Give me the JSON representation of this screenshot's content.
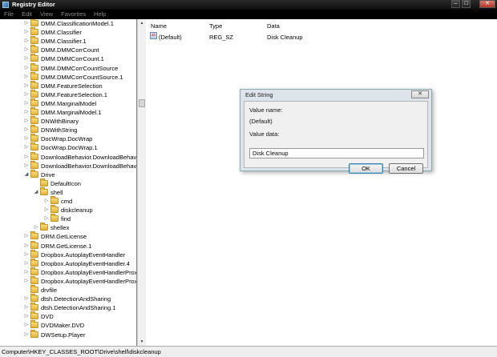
{
  "window": {
    "title": "Registry Editor"
  },
  "menu": [
    "File",
    "Edit",
    "View",
    "Favorites",
    "Help"
  ],
  "tree": {
    "items": [
      {
        "label": "DMM.ClassificationModel.1",
        "level": 0,
        "expand": "▷"
      },
      {
        "label": "DMM.Classifier",
        "level": 0,
        "expand": "▷"
      },
      {
        "label": "DMM.Classifier.1",
        "level": 0,
        "expand": "▷"
      },
      {
        "label": "DMM.DMMCorrCount",
        "level": 0,
        "expand": "▷"
      },
      {
        "label": "DMM.DMMCorrCount.1",
        "level": 0,
        "expand": "▷"
      },
      {
        "label": "DMM.DMMCorrCountSource",
        "level": 0,
        "expand": "▷"
      },
      {
        "label": "DMM.DMMCorrCountSource.1",
        "level": 0,
        "expand": "▷"
      },
      {
        "label": "DMM.FeatureSelection",
        "level": 0,
        "expand": "▷"
      },
      {
        "label": "DMM.FeatureSelection.1",
        "level": 0,
        "expand": "▷"
      },
      {
        "label": "DMM.MarginalModel",
        "level": 0,
        "expand": "▷"
      },
      {
        "label": "DMM.MarginalModel.1",
        "level": 0,
        "expand": "▷"
      },
      {
        "label": "DNWithBinary",
        "level": 0,
        "expand": "▷"
      },
      {
        "label": "DNWithString",
        "level": 0,
        "expand": "▷"
      },
      {
        "label": "DocWrap.DocWrap",
        "level": 0,
        "expand": "▷"
      },
      {
        "label": "DocWrap.DocWrap.1",
        "level": 0,
        "expand": "▷"
      },
      {
        "label": "DownloadBehavior.DownloadBehavic",
        "level": 0,
        "expand": "▷"
      },
      {
        "label": "DownloadBehavior.DownloadBehavic",
        "level": 0,
        "expand": "▷"
      },
      {
        "label": "Drive",
        "level": 0,
        "expand": "◢"
      },
      {
        "label": "DefaultIcon",
        "level": 1,
        "expand": ""
      },
      {
        "label": "shell",
        "level": 1,
        "expand": "◢"
      },
      {
        "label": "cmd",
        "level": 2,
        "expand": "▷"
      },
      {
        "label": "diskcleanup",
        "level": 2,
        "expand": "▷"
      },
      {
        "label": "find",
        "level": 2,
        "expand": "▷"
      },
      {
        "label": "shellex",
        "level": 1,
        "expand": "▷"
      },
      {
        "label": "DRM.GetLicense",
        "level": 0,
        "expand": "▷"
      },
      {
        "label": "DRM.GetLicense.1",
        "level": 0,
        "expand": "▷"
      },
      {
        "label": "Dropbox.AutoplayEventHandler",
        "level": 0,
        "expand": "▷"
      },
      {
        "label": "Dropbox.AutoplayEventHandler.4",
        "level": 0,
        "expand": "▷"
      },
      {
        "label": "Dropbox.AutoplayEventHandlerProxy",
        "level": 0,
        "expand": "▷"
      },
      {
        "label": "Dropbox.AutoplayEventHandlerProxy",
        "level": 0,
        "expand": "▷"
      },
      {
        "label": "drvfile",
        "level": 0,
        "expand": ""
      },
      {
        "label": "dtsh.DetectionAndSharing",
        "level": 0,
        "expand": "▷"
      },
      {
        "label": "dtsh.DetectionAndSharing.1",
        "level": 0,
        "expand": "▷"
      },
      {
        "label": "DVD",
        "level": 0,
        "expand": "▷"
      },
      {
        "label": "DVDMaker.DVD",
        "level": 0,
        "expand": "▷"
      },
      {
        "label": "DWSetup.Player",
        "level": 0,
        "expand": "▷"
      }
    ]
  },
  "values": {
    "headers": {
      "name": "Name",
      "type": "Type",
      "data": "Data"
    },
    "row": {
      "name": "(Default)",
      "type": "REG_SZ",
      "data": "Disk Cleanup",
      "icon": "ab"
    }
  },
  "status": "Computer\\HKEY_CLASSES_ROOT\\Drive\\shell\\diskcleanup",
  "dialog": {
    "title": "Edit String",
    "close": "✕",
    "value_name_label": "Value name:",
    "value_name": "(Default)",
    "value_data_label": "Value data:",
    "value_data": "Disk Cleanup",
    "ok": "OK",
    "cancel": "Cancel"
  }
}
